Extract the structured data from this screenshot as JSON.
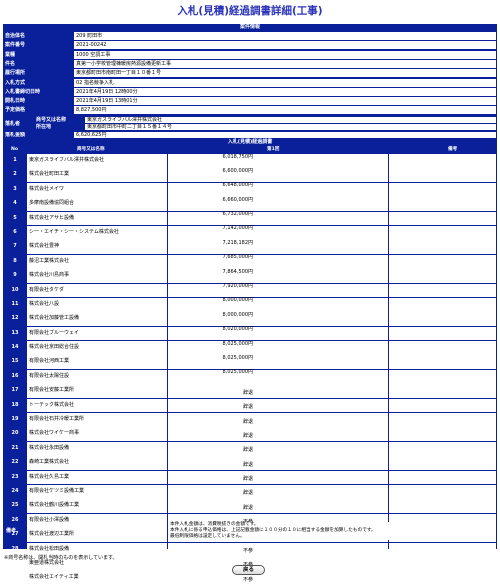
{
  "page": {
    "title": "入札(見積)経過調書詳細(工事)"
  },
  "case_info": {
    "heading": "案件情報",
    "fields": [
      {
        "label": "自治体名",
        "value": "209 町田市"
      },
      {
        "label": "案件番号",
        "value": "2021-00242"
      },
      {
        "label": "業種",
        "value": "1000 空調工事"
      },
      {
        "label": "件名",
        "value": "真第一小学校管理棟暖房熱源設備更新工事"
      },
      {
        "label": "履行場所",
        "value": "東京都町田市南町田一丁目１０番１号"
      },
      {
        "label": "入札方式",
        "value": "02 指名競争入札"
      },
      {
        "label": "入札書締切日時",
        "value": "2021年4月19日 12時00分"
      },
      {
        "label": "開札日時",
        "value": "2021年4月19日 13時01分"
      },
      {
        "label": "予定価格",
        "value": "8,827,500円"
      }
    ],
    "representative": {
      "label": "落札者",
      "name_label": "商号又は名称",
      "name": "東京ガスライフバル澤井株式会社",
      "address_label": "所在地",
      "address": "東京都町田市中町二丁目１５番１４号"
    },
    "award_amount": {
      "label": "落札金額",
      "value": "6,620,625円"
    }
  },
  "progress": {
    "heading": "入札(見積)経過調書",
    "columns": {
      "no": "No",
      "name": "商号又は名称",
      "round": "第1回",
      "note": "備考"
    },
    "rows": [
      {
        "no": "1",
        "name": "東京ガスライフバル澤井株式会社",
        "amount": "6,018,750円",
        "status": ""
      },
      {
        "no": "2",
        "name": "株式会社町田工業",
        "amount": "6,600,000円",
        "status": ""
      },
      {
        "no": "3",
        "name": "株式会社メイワ",
        "amount": "6,648,000円",
        "status": ""
      },
      {
        "no": "4",
        "name": "多摩南設備協同組合",
        "amount": "6,660,000円",
        "status": ""
      },
      {
        "no": "5",
        "name": "株式会社アサヒ設備",
        "amount": "6,732,000円",
        "status": ""
      },
      {
        "no": "6",
        "name": "シー・エイチ・シー・システム株式会社",
        "amount": "7,142,000円",
        "status": ""
      },
      {
        "no": "7",
        "name": "株式会社豊神",
        "amount": "7,218,182円",
        "status": ""
      },
      {
        "no": "8",
        "name": "藤沼工業株式会社",
        "amount": "7,685,000円",
        "status": ""
      },
      {
        "no": "9",
        "name": "株式会社川島商事",
        "amount": "7,864,500円",
        "status": ""
      },
      {
        "no": "10",
        "name": "有限会社タケダ",
        "amount": "7,920,000円",
        "status": ""
      },
      {
        "no": "11",
        "name": "株式会社八設",
        "amount": "8,000,000円",
        "status": ""
      },
      {
        "no": "12",
        "name": "株式会社加藤管工設備",
        "amount": "8,000,000円",
        "status": ""
      },
      {
        "no": "13",
        "name": "有限会社ブルーウェイ",
        "amount": "8,020,000円",
        "status": ""
      },
      {
        "no": "14",
        "name": "株式会社京田総合住設",
        "amount": "8,025,000円",
        "status": ""
      },
      {
        "no": "15",
        "name": "有限会社河西工業",
        "amount": "8,025,000円",
        "status": ""
      },
      {
        "no": "16",
        "name": "有限会社太陽住設",
        "amount": "8,025,000円",
        "status": ""
      },
      {
        "no": "17",
        "name": "有限会社安藤工業所",
        "amount": "",
        "status": "辞退"
      },
      {
        "no": "18",
        "name": "トーテック株式会社",
        "amount": "",
        "status": "辞退"
      },
      {
        "no": "19",
        "name": "有限会社石井冷暖工業所",
        "amount": "",
        "status": "辞退"
      },
      {
        "no": "20",
        "name": "株式会社ワイケー商事",
        "amount": "",
        "status": "辞退"
      },
      {
        "no": "21",
        "name": "株式会社永田設備",
        "amount": "",
        "status": "辞退"
      },
      {
        "no": "22",
        "name": "森崎工業株式会社",
        "amount": "",
        "status": "辞退"
      },
      {
        "no": "23",
        "name": "株式会社久島工業",
        "amount": "",
        "status": "辞退"
      },
      {
        "no": "24",
        "name": "有限会社ケツミ設備工業",
        "amount": "",
        "status": "辞退"
      },
      {
        "no": "25",
        "name": "株式会社鶴川設備工業",
        "amount": "",
        "status": "辞退"
      },
      {
        "no": "26",
        "name": "有限会社小澤設備",
        "amount": "",
        "status": "不参"
      },
      {
        "no": "27",
        "name": "株式会社渡辺工業所",
        "amount": "",
        "status": "不参"
      },
      {
        "no": "28",
        "name": "株式会社松田設備",
        "amount": "",
        "status": "不参"
      },
      {
        "no": "29",
        "name": "東亜道株式会社",
        "amount": "",
        "status": "不参"
      },
      {
        "no": "30",
        "name": "株式会社エイティ工業",
        "amount": "",
        "status": "不参"
      }
    ],
    "remarks": {
      "label": "備考",
      "lines": [
        "本件入札金額は、消費税抜きの金額です。",
        "本件入札に係る申込価格は、上記記載金額に１００分の１０に相当する金額を加算したものです。",
        "最低制限価格は設定していません。"
      ]
    }
  },
  "footnote": "※商号名称は、開札当時のものを表示しています。",
  "back_button": "戻る",
  "colors": {
    "frame": "#0a1f9a",
    "title": "#2b33b8"
  }
}
